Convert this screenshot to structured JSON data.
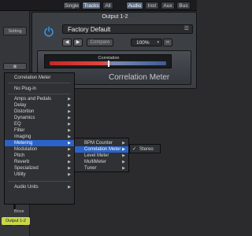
{
  "tabs": [
    {
      "label": "Single",
      "active": false
    },
    {
      "label": "Tracks",
      "active": true
    },
    {
      "label": "All",
      "active": false
    },
    {
      "label": "Audio",
      "active": true
    },
    {
      "label": "Inst",
      "active": false
    },
    {
      "label": "Aux",
      "active": false
    },
    {
      "label": "Bus",
      "active": false
    }
  ],
  "left_strip": {
    "setting_label": "Setting",
    "bnce_label": "Bnce",
    "m_label": "M",
    "s_label": "S",
    "output_label": "Output 1-2"
  },
  "plugin": {
    "title": "Output 1-2",
    "preset": "Factory Default",
    "compare_label": "Compare",
    "zoom": "100%",
    "meter_label": "Correlation",
    "meter_title": "Correlation Meter"
  },
  "menu_main": {
    "header": "Correlation Meter",
    "no_plugin": "No Plug-in",
    "items": [
      "Amps and Pedals",
      "Delay",
      "Distortion",
      "Dynamics",
      "EQ",
      "Filter",
      "Imaging",
      "Metering",
      "Modulation",
      "Pitch",
      "Reverb",
      "Specialized",
      "Utility"
    ],
    "selected": "Metering",
    "footer": "Audio Units"
  },
  "menu_metering": {
    "items": [
      "BPM Counter",
      "Correlation Meter",
      "Level Meter",
      "MultiMeter",
      "Tuner"
    ],
    "selected": "Correlation Meter"
  },
  "menu_correlation": {
    "items": [
      "Stereo"
    ],
    "checked": "Stereo"
  },
  "colors": {
    "accent": "#2a63c9",
    "power": "#3a8fe0",
    "output_badge": "#c8d64a"
  },
  "icons": {
    "power": "power-icon",
    "link": "link-icon",
    "preset_menu": "list-icon"
  }
}
